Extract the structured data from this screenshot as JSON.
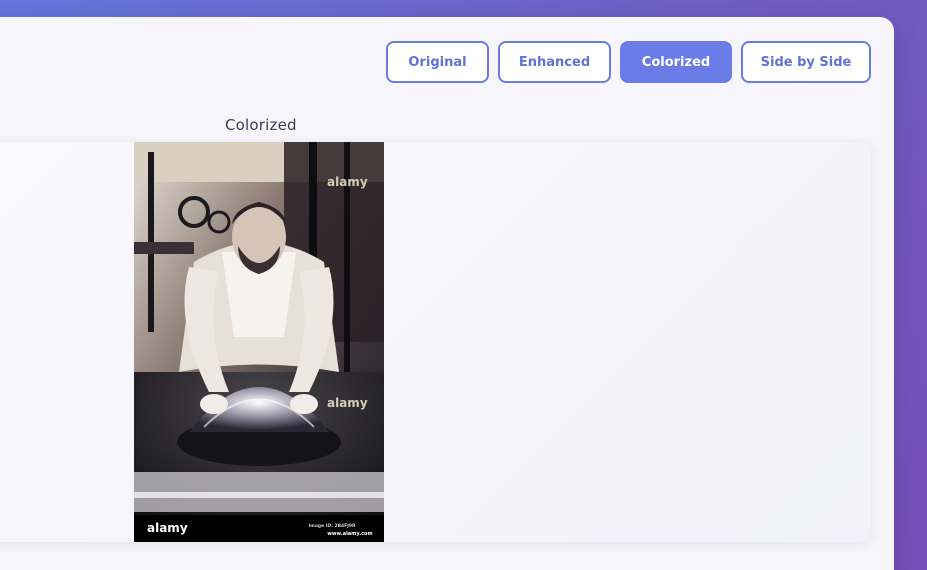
{
  "view_toggle": {
    "original_label": "Original",
    "enhanced_label": "Enhanced",
    "colorized_label": "Colorized",
    "side_by_side_label": "Side by Side",
    "active": "Colorized"
  },
  "preview": {
    "label": "Colorized",
    "watermark": {
      "brand": "alamy",
      "image_id": "Image ID: 2B4FJ9R",
      "url": "www.alamy.com"
    }
  },
  "colors": {
    "accent": "#6a7ce8",
    "panel": "#f5f5fb",
    "background_start": "#6477dc",
    "background_end": "#7650b6"
  }
}
